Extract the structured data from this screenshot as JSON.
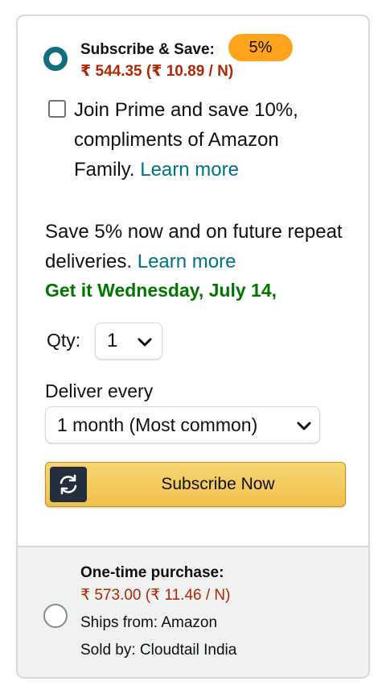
{
  "subscribe_option": {
    "title": "Subscribe & Save:",
    "discount_badge": "5%",
    "price": "₹ 544.35 (₹ 10.89 / N)",
    "selected": true
  },
  "prime_offer": {
    "text": "Join Prime and save 10%, compliments of Amazon Family.",
    "link": "Learn more",
    "checked": false
  },
  "savings_info": {
    "text": "Save 5% now and on future repeat deliveries.",
    "link": "Learn more"
  },
  "delivery_date": "Get it Wednesday, July 14,",
  "quantity": {
    "label": "Qty:",
    "value": "1"
  },
  "deliver_every": {
    "label": "Deliver every",
    "value": "1 month (Most common)"
  },
  "subscribe_button": {
    "label": "Subscribe Now",
    "icon": "refresh-icon"
  },
  "one_time_option": {
    "title": "One-time purchase:",
    "price": "₹ 573.00 (₹ 11.46 / N)",
    "ships_from": "Ships from: Amazon",
    "sold_by": "Sold by: Cloudtail India",
    "selected": false
  },
  "colors": {
    "accent_teal": "#0f6f7d",
    "badge_orange": "#ffa41c",
    "price_red": "#b12704",
    "delivery_green": "#007600",
    "link_teal": "#007185",
    "button_yellow": "#f0c14b"
  }
}
